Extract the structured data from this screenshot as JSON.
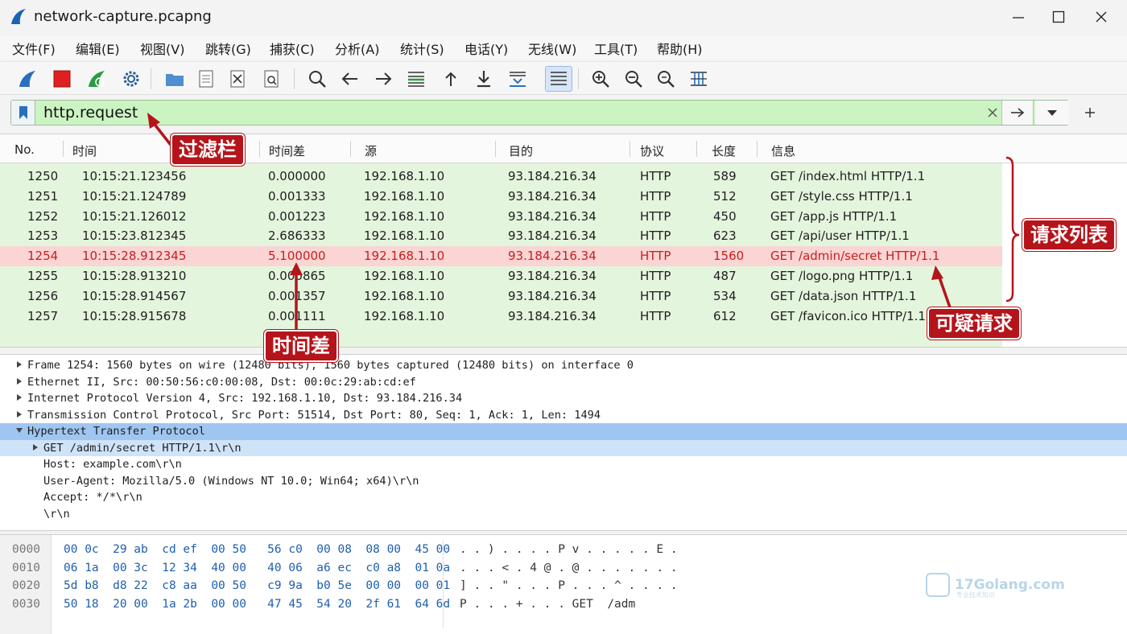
{
  "window": {
    "title": "network-capture.pcapng",
    "minimize": "—",
    "maximize": "☐",
    "close": "✕"
  },
  "menu": [
    "文件(F)",
    "编辑(E)",
    "视图(V)",
    "跳转(G)",
    "捕获(C)",
    "分析(A)",
    "统计(S)",
    "电话(Y)",
    "无线(W)",
    "工具(T)",
    "帮助(H)"
  ],
  "toolbar": {
    "icons": [
      "shark-fin-start-icon",
      "stop-capture-icon",
      "restart-capture-icon",
      "capture-options-icon",
      "open-file-icon",
      "save-file-icon",
      "close-file-icon",
      "reload-file-icon",
      "find-packet-icon",
      "go-back-icon",
      "go-forward-icon",
      "go-to-packet-icon",
      "go-first-icon",
      "go-last-icon",
      "auto-scroll-icon",
      "colorize-icon",
      "zoom-in-icon",
      "zoom-out-icon",
      "zoom-normal-icon",
      "resize-columns-icon"
    ]
  },
  "filter": {
    "value": "http.request",
    "apply_label": "→",
    "add_label": "+"
  },
  "packet_list": {
    "columns": [
      "No.",
      "时间",
      "时间差",
      "源",
      "目的",
      "协议",
      "长度",
      "信息"
    ],
    "rows": [
      {
        "no": "1250",
        "time": "10:15:21.123456",
        "delta": "0.000000",
        "src": "192.168.1.10",
        "dst": "93.184.216.34",
        "proto": "HTTP",
        "len": "589",
        "info": "GET /index.html HTTP/1.1"
      },
      {
        "no": "1251",
        "time": "10:15:21.124789",
        "delta": "0.001333",
        "src": "192.168.1.10",
        "dst": "93.184.216.34",
        "proto": "HTTP",
        "len": "512",
        "info": "GET /style.css HTTP/1.1"
      },
      {
        "no": "1252",
        "time": "10:15:21.126012",
        "delta": "0.001223",
        "src": "192.168.1.10",
        "dst": "93.184.216.34",
        "proto": "HTTP",
        "len": "450",
        "info": "GET /app.js HTTP/1.1"
      },
      {
        "no": "1253",
        "time": "10:15:23.812345",
        "delta": "2.686333",
        "src": "192.168.1.10",
        "dst": "93.184.216.34",
        "proto": "HTTP",
        "len": "623",
        "info": "GET /api/user HTTP/1.1"
      },
      {
        "no": "1254",
        "time": "10:15:28.912345",
        "delta": "5.100000",
        "src": "192.168.1.10",
        "dst": "93.184.216.34",
        "proto": "HTTP",
        "len": "1560",
        "info": "GET /admin/secret HTTP/1.1"
      },
      {
        "no": "1255",
        "time": "10:15:28.913210",
        "delta": "0.000865",
        "src": "192.168.1.10",
        "dst": "93.184.216.34",
        "proto": "HTTP",
        "len": "487",
        "info": "GET /logo.png HTTP/1.1"
      },
      {
        "no": "1256",
        "time": "10:15:28.914567",
        "delta": "0.001357",
        "src": "192.168.1.10",
        "dst": "93.184.216.34",
        "proto": "HTTP",
        "len": "534",
        "info": "GET /data.json HTTP/1.1"
      },
      {
        "no": "1257",
        "time": "10:15:28.915678",
        "delta": "0.001111",
        "src": "192.168.1.10",
        "dst": "93.184.216.34",
        "proto": "HTTP",
        "len": "612",
        "info": "GET /favicon.ico HTTP/1.1"
      }
    ],
    "selected_index": 4
  },
  "details": [
    {
      "arrow": "right",
      "indent": 0,
      "text": "Frame 1254: 1560 bytes on wire (12480 bits), 1560 bytes captured (12480 bits) on interface 0",
      "state": ""
    },
    {
      "arrow": "right",
      "indent": 0,
      "text": "Ethernet II, Src: 00:50:56:c0:00:08, Dst: 00:0c:29:ab:cd:ef",
      "state": ""
    },
    {
      "arrow": "right",
      "indent": 0,
      "text": "Internet Protocol Version 4, Src: 192.168.1.10, Dst: 93.184.216.34",
      "state": ""
    },
    {
      "arrow": "right",
      "indent": 0,
      "text": "Transmission Control Protocol, Src Port: 51514, Dst Port: 80, Seq: 1, Ack: 1, Len: 1494",
      "state": ""
    },
    {
      "arrow": "down",
      "indent": 0,
      "text": "Hypertext Transfer Protocol",
      "state": "sel"
    },
    {
      "arrow": "right",
      "indent": 1,
      "text": "GET /admin/secret HTTP/1.1\\r\\n",
      "state": "sub-sel"
    },
    {
      "arrow": "",
      "indent": 1,
      "text": "Host: example.com\\r\\n",
      "state": ""
    },
    {
      "arrow": "",
      "indent": 1,
      "text": "User-Agent: Mozilla/5.0 (Windows NT 10.0; Win64; x64)\\r\\n",
      "state": ""
    },
    {
      "arrow": "",
      "indent": 1,
      "text": "Accept: */*\\r\\n",
      "state": ""
    },
    {
      "arrow": "",
      "indent": 1,
      "text": "\\r\\n",
      "state": ""
    }
  ],
  "hex": [
    {
      "offset": "0000",
      "bytes": "00 0c  29 ab  cd ef  00 50   56 c0  00 08  08 00  45 00",
      "ascii": ". . ) . . . . P v . . . . . E ."
    },
    {
      "offset": "0010",
      "bytes": "06 1a  00 3c  12 34  40 00   40 06  a6 ec  c0 a8  01 0a",
      "ascii": ". . . < . 4 @ . @ . . . . . . ."
    },
    {
      "offset": "0020",
      "bytes": "5d b8  d8 22  c8 aa  00 50   c9 9a  b0 5e  00 00  00 01",
      "ascii": "] . . \" . . . P . . . ^ . . . ."
    },
    {
      "offset": "0030",
      "bytes": "50 18  20 00  1a 2b  00 00   47 45  54 20  2f 61  64 6d",
      "ascii": "P . . . + . . . GET  /adm"
    }
  ],
  "annotations": {
    "filter_bar": "过滤栏",
    "request_list": "请求列表",
    "time_delta": "时间差",
    "suspicious": "可疑请求"
  },
  "watermark": {
    "text": "17Golang.com",
    "sub": "专业技术知识"
  },
  "colors": {
    "annotation_red": "#b5141b",
    "filter_green": "#ccf4c3",
    "row_green": "#e4f5dd",
    "row_selected": "#fbd4d4",
    "detail_selected": "#9fc6f1"
  }
}
